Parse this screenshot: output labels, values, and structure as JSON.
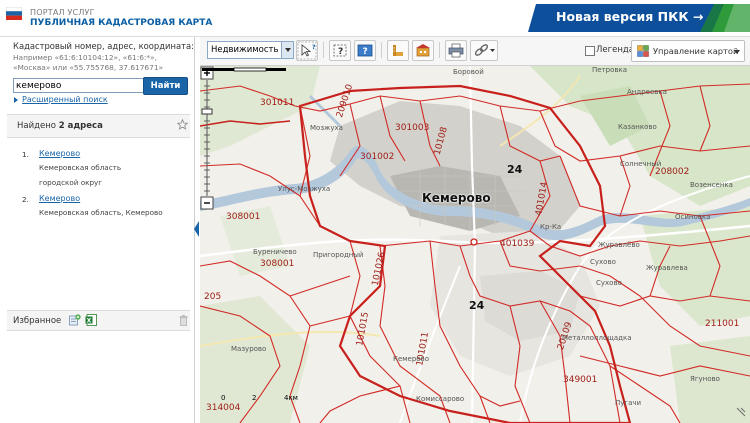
{
  "header": {
    "portal_label": "ПОРТАЛ УСЛУГ",
    "map_title": "ПУБЛИЧНАЯ КАДАСТРОВАЯ КАРТА",
    "new_version_link": "Новая версия ПКК →",
    "colors": {
      "brand_blue": "#1a64a8",
      "banner_blue": "#0e4f9c",
      "banner_green": "#2e9b3a"
    }
  },
  "search": {
    "hint_title": "Кадастровый номер, адрес, координата:",
    "hint_example_1": "Например «61:6:10104:12», «61:6:*»,",
    "hint_example_2": "«Москва» или «55.755768, 37.617671»",
    "query_value": "кемерово",
    "submit_label": "Найти",
    "advanced_link": "Расширенный поиск"
  },
  "results": {
    "found_prefix": "Найдено ",
    "found_count": "2 адреса",
    "items": [
      {
        "index": "1.",
        "name": "Кемерово",
        "line1": "Кемеровская область",
        "line2": "городской округ"
      },
      {
        "index": "2.",
        "name": "Кемерово",
        "line1": "Кемеровская область, Кемерово"
      }
    ]
  },
  "favorites": {
    "title": "Избранное"
  },
  "toolbar": {
    "layer_selected": "Недвижимость",
    "legend_label": "Легенда",
    "map_control_label": "Управление картой"
  },
  "map": {
    "city_label": "Кемерово",
    "cadastral_labels": [
      "301011",
      "301003",
      "301002",
      "10108",
      "24",
      "401014",
      "208002",
      "308001",
      "308001",
      "101026",
      "401039",
      "24",
      "101015",
      "101011",
      "20109",
      "211001",
      "349001",
      "314004",
      "205",
      "209010"
    ],
    "place_labels": [
      "Боровой",
      "Петровка",
      "Андреевка",
      "Мозжуха",
      "Казанково",
      "Солнечный",
      "Возенсенка",
      "Улус-Мозжуха",
      "Осиновка",
      "Буреничево",
      "Пригородный",
      "Журавлёво",
      "Кр-Ка",
      "Журавлева",
      "Сухово",
      "Металлоплощадка",
      "Мазурово",
      "Кемерово",
      "Комиссарово",
      "Сухово",
      "Пугачи",
      "Ягуново"
    ],
    "scale": {
      "zero": "0",
      "mid": "2",
      "end": "4км"
    }
  }
}
